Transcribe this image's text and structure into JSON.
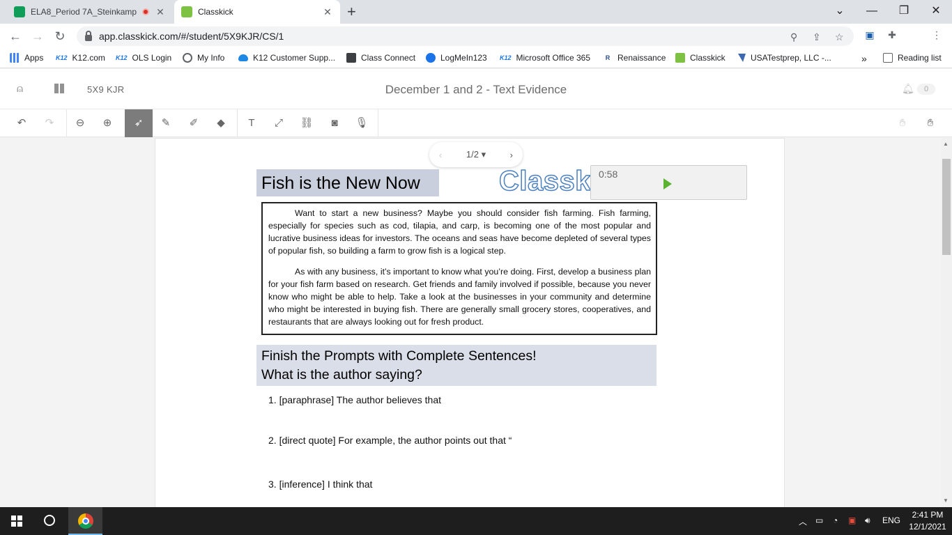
{
  "browser": {
    "tabs": [
      {
        "title": "ELA8_Period 7A_Steinkamp -",
        "active": false,
        "recording": true
      },
      {
        "title": "Classkick",
        "active": true
      }
    ],
    "new_tab_icon": "plus-icon",
    "url": "app.classkick.com/#/student/5X9KJR/CS/1",
    "bookmarks": [
      "Apps",
      "K12.com",
      "OLS Login",
      "My Info",
      "K12 Customer Supp...",
      "Class Connect",
      "LogMeIn123",
      "Microsoft Office 365",
      "Renaissance",
      "Classkick",
      "USATestprep, LLC -..."
    ],
    "bookmarks_overflow": "»",
    "reading_list": "Reading list",
    "k12_mark": "K12"
  },
  "app": {
    "class_code": "5X9 KJR",
    "assignment_title": "December 1 and 2 - Text Evidence",
    "notification_count": "0",
    "pager": {
      "label": "1/2",
      "prev_icon": "chevron-left-icon",
      "next_icon": "chevron-right-icon"
    }
  },
  "document": {
    "title": "Fish is the New Now",
    "logo_text": "Classkick",
    "audio_time": "0:58",
    "paragraphs": [
      "Want to start a new business? Maybe you should consider fish farming. Fish farming, especially for species such as cod, tilapia, and carp, is becoming one of the most popular and lucrative business ideas for investors. The oceans and seas have become depleted of several types of popular fish, so building a farm to grow fish is a logical step.",
      "As with any business, it’s important to know what you’re doing. First, develop a business plan for your fish farm based on research. Get friends and family involved if possible, because you never know who might be able to help. Take a look at the businesses in your community and determine who might be interested in buying fish. There are generally small grocery stores, cooperatives, and restaurants that are always looking out for fresh product."
    ],
    "prompt_heading_1": "Finish the Prompts with Complete Sentences!",
    "prompt_heading_2": "What is the author saying?",
    "items": [
      "1. [paraphrase] The author believes that",
      "2. [direct quote] For example, the author points out that “",
      "3. [inference] I think that"
    ]
  },
  "taskbar": {
    "language": "ENG",
    "time": "2:41 PM",
    "date": "12/1/2021"
  },
  "colors": {
    "title_highlight": "#c9cfdc",
    "prompt_highlight": "#dadee8",
    "active_tool": "#7c7c7c",
    "play": "#5cb230"
  }
}
